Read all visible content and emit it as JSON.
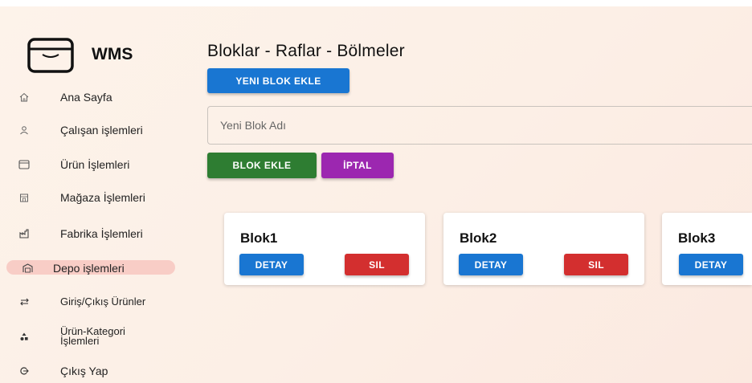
{
  "app": {
    "name": "WMS"
  },
  "sidebar": {
    "items": [
      {
        "label": "Ana Sayfa",
        "icon": "home-icon"
      },
      {
        "label": "Çalışan işlemleri",
        "icon": "user-icon"
      },
      {
        "label": "Ürün İşlemleri",
        "icon": "box-icon"
      },
      {
        "label": "Mağaza İşlemleri",
        "icon": "store-icon"
      },
      {
        "label": "Fabrika İşlemleri",
        "icon": "factory-icon"
      },
      {
        "label": "Depo işlemleri",
        "icon": "warehouse-icon",
        "active": true
      },
      {
        "label": "Giriş/Çıkış Ürünler",
        "icon": "swap-icon"
      },
      {
        "label": "Ürün-Kategori İşlemleri",
        "icon": "category-icon"
      },
      {
        "label": "Çıkış Yap",
        "icon": "logout-icon"
      }
    ]
  },
  "main": {
    "title": "Bloklar - Raflar - Bölmeler",
    "new_block_button": "YENI BLOK EKLE",
    "new_block_input": {
      "placeholder": "Yeni Blok Adı",
      "value": ""
    },
    "add_button": "BLOK EKLE",
    "cancel_button": "İPTAL",
    "blocks": [
      {
        "name": "Blok1",
        "detail_label": "DETAY",
        "delete_label": "SIL"
      },
      {
        "name": "Blok2",
        "detail_label": "DETAY",
        "delete_label": "SIL"
      },
      {
        "name": "Blok3",
        "detail_label": "DETAY"
      }
    ]
  },
  "colors": {
    "primary": "#1976d2",
    "success": "#2e7d32",
    "secondary": "#9c27b0",
    "danger": "#d32f2f",
    "active_nav_bg": "#f8cdc6"
  }
}
